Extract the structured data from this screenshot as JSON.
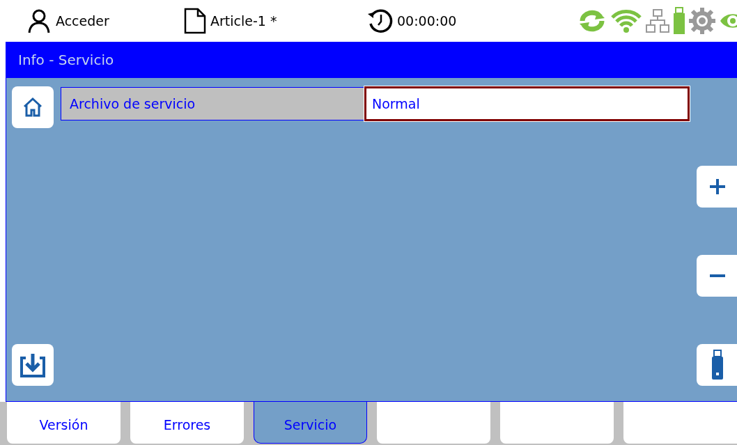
{
  "header": {
    "user": "Acceder",
    "document": "Article-1 *",
    "timer": "00:00:00"
  },
  "title": "Info - Servicio",
  "setting": {
    "label": "Archivo de servicio",
    "value": "Normal"
  },
  "tabs": [
    {
      "label": "Versión",
      "selected": false
    },
    {
      "label": "Errores",
      "selected": false
    },
    {
      "label": "Servicio",
      "selected": true
    },
    {
      "selected": false
    },
    {
      "selected": false
    },
    {
      "selected": false
    }
  ]
}
